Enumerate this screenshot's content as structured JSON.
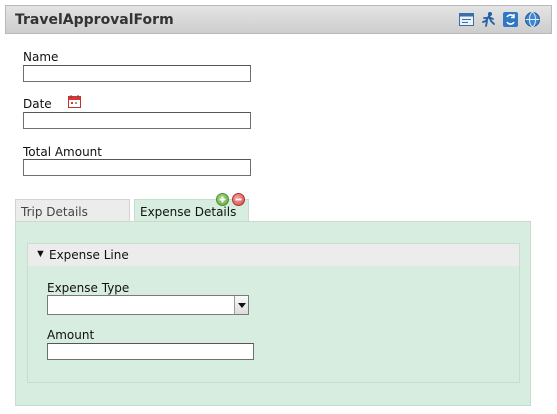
{
  "header": {
    "title": "TravelApprovalForm",
    "icons": [
      "form-view-icon",
      "run-icon",
      "refresh-icon",
      "globe-icon"
    ]
  },
  "fields": {
    "name": {
      "label": "Name",
      "value": ""
    },
    "date": {
      "label": "Date",
      "value": ""
    },
    "total_amount": {
      "label": "Total Amount",
      "value": ""
    }
  },
  "tabs": [
    {
      "label": "Trip Details",
      "active": false
    },
    {
      "label": "Expense Details",
      "active": true
    }
  ],
  "expense_line": {
    "title": "Expense Line",
    "expense_type": {
      "label": "Expense Type",
      "value": ""
    },
    "amount": {
      "label": "Amount",
      "value": ""
    }
  },
  "colors": {
    "panel_bg": "#d6eddf",
    "header_bg": "#d7d7d7",
    "add_button": "#5ea63b",
    "remove_button": "#d84848"
  }
}
